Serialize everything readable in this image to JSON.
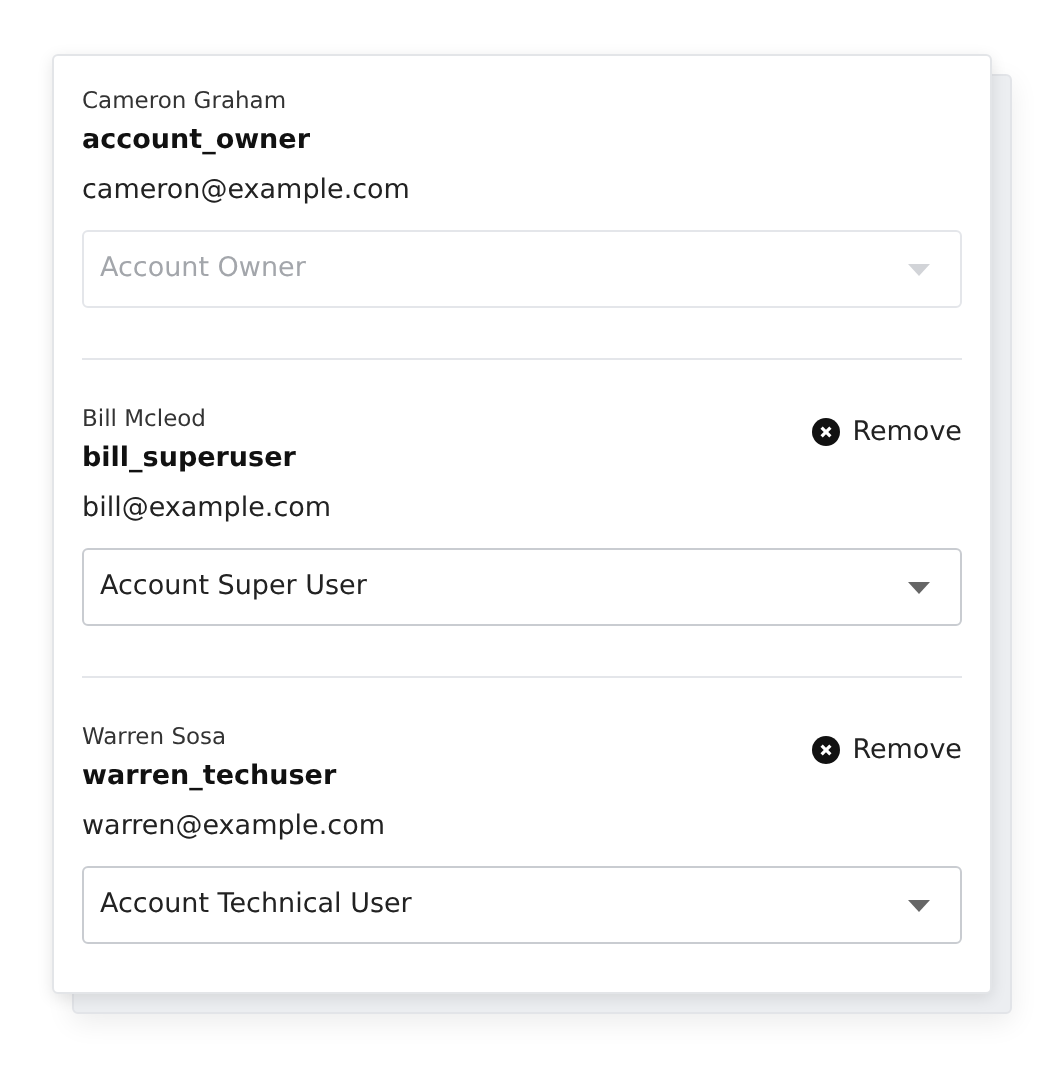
{
  "members": [
    {
      "name": "Cameron Graham",
      "username": "account_owner",
      "email": "cameron@example.com",
      "role": "Account Owner",
      "disabled": true
    },
    {
      "name": "Bill Mcleod",
      "username": "bill_superuser",
      "email": "bill@example.com",
      "role": "Account Super User",
      "disabled": false,
      "remove_label": "Remove"
    },
    {
      "name": "Warren Sosa",
      "username": "warren_techuser",
      "email": "warren@example.com",
      "role": "Account Technical User",
      "disabled": false,
      "remove_label": "Remove"
    }
  ]
}
